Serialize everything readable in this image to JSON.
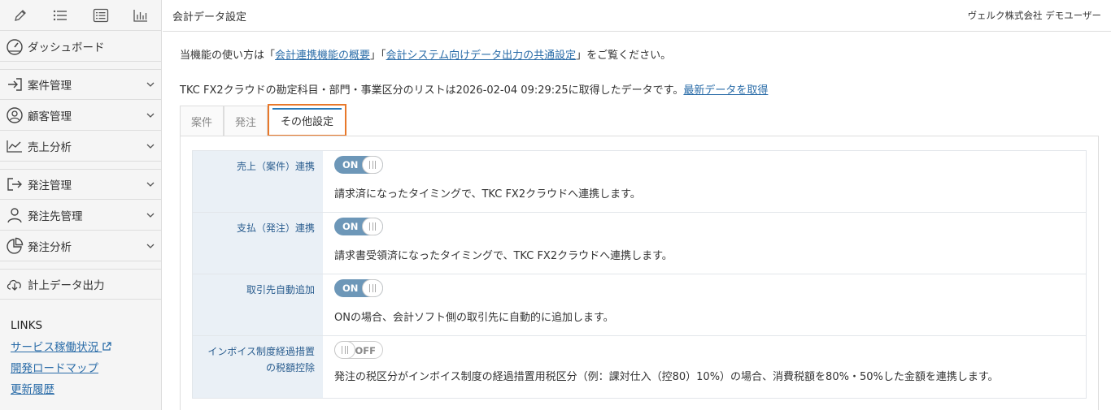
{
  "sidebar": {
    "toolbar": [
      "pencil-icon",
      "list-icon",
      "detail-list-icon",
      "bar-chart-icon"
    ],
    "items": [
      {
        "label": "ダッシュボード",
        "icon": "dashboard-icon",
        "chevron": false
      },
      {
        "label": "案件管理",
        "icon": "login-icon",
        "chevron": true
      },
      {
        "label": "顧客管理",
        "icon": "user-circle-icon",
        "chevron": true
      },
      {
        "label": "売上分析",
        "icon": "line-chart-icon",
        "chevron": true
      },
      {
        "label": "発注管理",
        "icon": "logout-icon",
        "chevron": true
      },
      {
        "label": "発注先管理",
        "icon": "person-icon",
        "chevron": true
      },
      {
        "label": "発注分析",
        "icon": "pie-chart-icon",
        "chevron": true
      },
      {
        "label": "計上データ出力",
        "icon": "cloud-download-icon",
        "chevron": false
      }
    ],
    "links": {
      "title": "LINKS",
      "items": [
        "サービス稼働状況",
        "開発ロードマップ",
        "更新履歴"
      ]
    }
  },
  "header": {
    "title": "会計データ設定",
    "user": "ヴェルク株式会社 デモユーザー"
  },
  "main": {
    "line1": {
      "prefix": "当機能の使い方は「",
      "link1": "会計連携機能の概要",
      "mid": "」「",
      "link2": "会計システム向けデータ出力の共通設定",
      "suffix": "」をご覧ください。"
    },
    "line2": {
      "text": "TKC FX2クラウドの勘定科目・部門・事業区分のリストは2026-02-04 09:29:25に取得したデータです。",
      "link": "最新データを取得"
    },
    "tabs": [
      "案件",
      "発注",
      "その他設定"
    ],
    "settings": [
      {
        "label": "売上（案件）連携",
        "state": "ON",
        "desc": "請求済になったタイミングで、TKC FX2クラウドへ連携します。"
      },
      {
        "label": "支払（発注）連携",
        "state": "ON",
        "desc": "請求書受領済になったタイミングで、TKC FX2クラウドへ連携します。"
      },
      {
        "label": "取引先自動追加",
        "state": "ON",
        "desc": "ONの場合、会計ソフト側の取引先に自動的に追加します。"
      },
      {
        "label": "インボイス制度経過措置の税額控除",
        "state": "OFF",
        "desc": "発注の税区分がインボイス制度の経過措置用税区分（例：課対仕入（控80）10%）の場合、消費税額を80%・50%した金額を連携します。"
      }
    ]
  }
}
